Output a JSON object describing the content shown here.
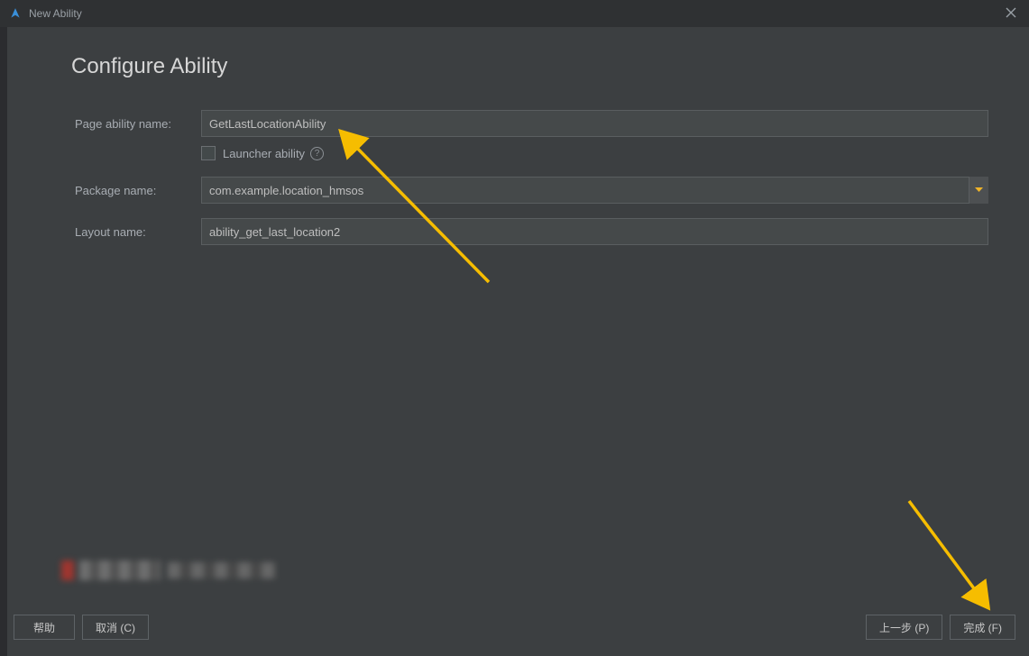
{
  "window": {
    "title": "New Ability"
  },
  "heading": "Configure Ability",
  "form": {
    "page_ability_name_label": "Page ability name:",
    "page_ability_name_value": "GetLastLocationAbility",
    "launcher_ability_label": "Launcher ability",
    "package_name_label": "Package name:",
    "package_name_value": "com.example.location_hmsos",
    "layout_name_label": "Layout name:",
    "layout_name_value": "ability_get_last_location2"
  },
  "buttons": {
    "help": "帮助",
    "cancel": "取消 (C)",
    "previous": "上一步 (P)",
    "finish": "完成 (F)"
  }
}
